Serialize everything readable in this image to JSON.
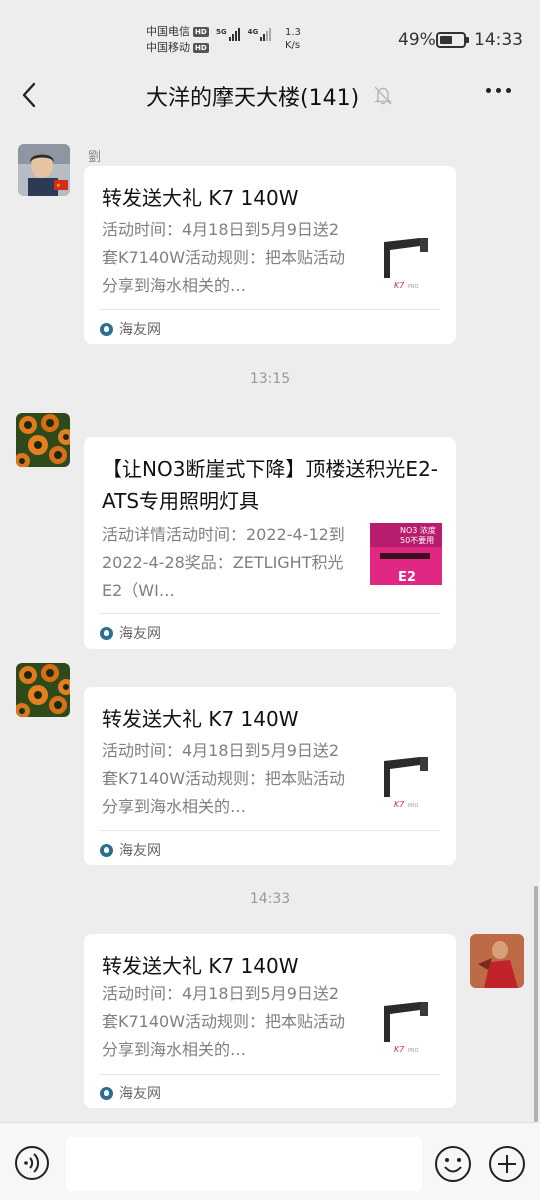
{
  "status": {
    "carrier1": "中国电信",
    "carrier2": "中国移动",
    "hd": "HD",
    "net1": "5G",
    "net2": "4G",
    "speed_value": "1.3",
    "speed_unit": "K/s",
    "battery": "49%",
    "battery_level": 0.49,
    "time": "14:33"
  },
  "header": {
    "title": "大洋的摩天大楼(141)",
    "back_icon": "chevron-left-icon",
    "mute_icon": "bell-off-icon",
    "more_icon": "more-dots-icon"
  },
  "messages": [
    {
      "sender": "劉",
      "title": "转发送大礼 K7 140W",
      "desc": "活动时间：4月18日到5月9日送2套K7140W活动规则：把本贴活动分享到海水相关的…",
      "source": "海友网"
    },
    {
      "title": "【让NO3断崖式下降】顶楼送积光E2-ATS专用照明灯具",
      "desc": "活动详情活动时间：2022-4-12到2022-4-28奖品：ZETLIGHT积光E2（WI…",
      "source": "海友网",
      "thumb_text_1": "NO3 浓度",
      "thumb_text_2": "50不要用",
      "thumb_text_3": "E2"
    },
    {
      "title": "转发送大礼 K7 140W",
      "desc": "活动时间：4月18日到5月9日送2套K7140W活动规则：把本贴活动分享到海水相关的…",
      "source": "海友网"
    },
    {
      "title": "转发送大礼 K7 140W",
      "desc": "活动时间：4月18日到5月9日送2套K7140W活动规则：把本贴活动分享到海水相关的…",
      "source": "海友网"
    }
  ],
  "timestamps": [
    "13:15",
    "14:33"
  ],
  "input": {
    "voice_icon": "voice-icon",
    "emoji_icon": "emoji-icon",
    "plus_icon": "plus-icon"
  }
}
